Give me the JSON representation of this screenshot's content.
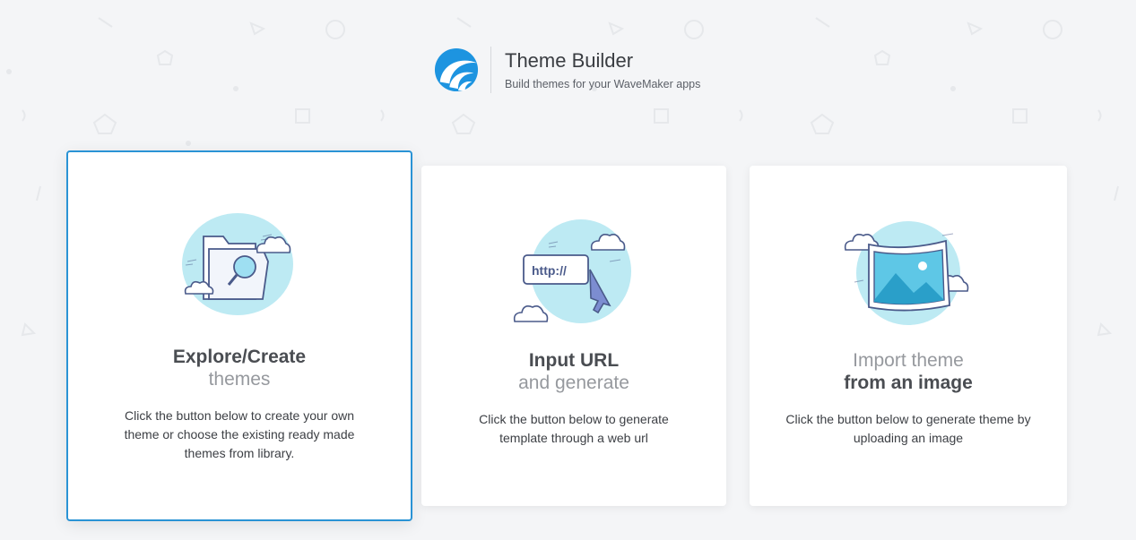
{
  "header": {
    "title": "Theme Builder",
    "subtitle": "Build themes for your WaveMaker apps"
  },
  "cards": [
    {
      "title_primary": "Explore/Create",
      "title_secondary": "themes",
      "description": "Click the button below to create your own theme or choose the existing ready made themes from library.",
      "illustration": "folder-search-icon",
      "selected": true
    },
    {
      "title_primary": "Input URL",
      "title_secondary": "and generate",
      "description": "Click the button below to generate template through a web url",
      "illustration_text": "http://",
      "illustration": "url-cursor-icon"
    },
    {
      "title_secondary": "Import theme",
      "title_primary": "from an image",
      "description": "Click the button below to generate theme by uploading an image",
      "illustration": "image-frame-icon"
    }
  ],
  "colors": {
    "accent": "#2a93d5",
    "cloud": "#bdeaf3",
    "illustration_stroke": "#4a5a8a"
  }
}
